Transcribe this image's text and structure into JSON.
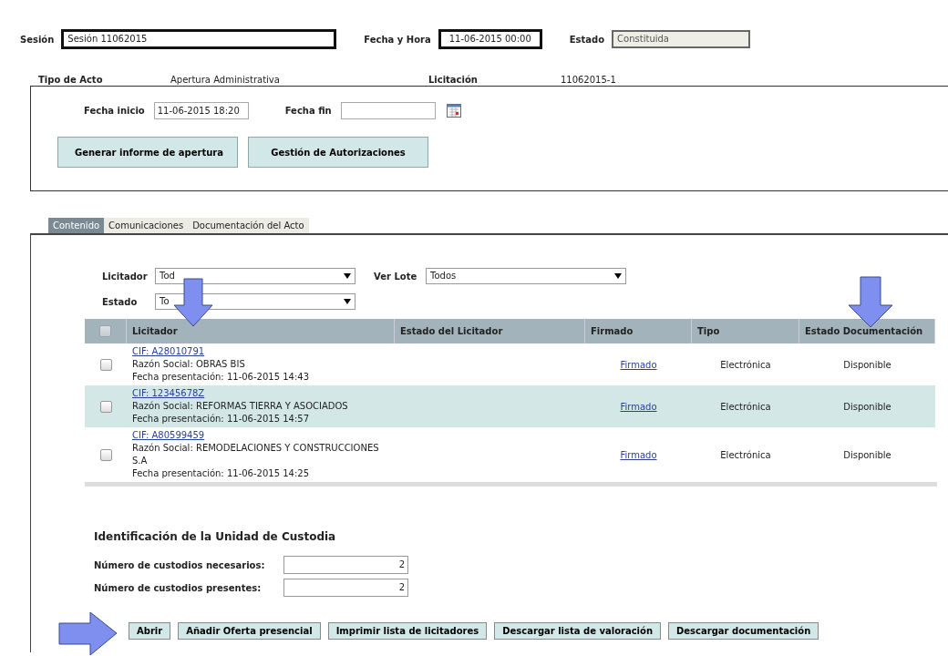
{
  "session": {
    "label": "Sesión",
    "value": "Sesión 11062015"
  },
  "date_time": {
    "label": "Fecha y Hora",
    "value": "11-06-2015 00:00"
  },
  "status": {
    "label": "Estado",
    "value": "Constituida",
    "disabled": true
  },
  "info": [
    {
      "label": "Tipo de Acto",
      "value": "Apertura Administrativa"
    },
    {
      "label": "Licitación",
      "value": "11062015-1"
    }
  ],
  "dates": [
    {
      "label": "Fecha inicio",
      "value": "11-06-2015 18:20"
    },
    {
      "label": "Fecha fin"
    }
  ],
  "panel_buttons": [
    "Generar informe de apertura",
    "Gestión de Autorizaciones"
  ],
  "tabs": [
    {
      "label": "Contenido",
      "selected": true
    },
    {
      "label": "Comunicaciones",
      "selected": false
    },
    {
      "label": "Documentación del Acto",
      "selected": false
    }
  ],
  "filters": [
    {
      "label": "Licitador",
      "value": "Tod"
    },
    {
      "label": "Ver Lote",
      "value": "Todos"
    },
    {
      "label": "Estado",
      "value": "To"
    }
  ],
  "table": {
    "select_all": {
      "disabled": true
    },
    "columns": [
      "Licitador",
      "Estado del Licitador",
      "Firmado",
      "Tipo",
      "Estado Documentación"
    ],
    "rows": [
      {
        "cif": "CIF: A28010791",
        "razon": "Razón Social: OBRAS BIS",
        "fecha": "Fecha presentación: 11-06-2015 14:43",
        "firmado": "Firmado",
        "tipo": "Electrónica",
        "estado_doc": "Disponible",
        "selected": false,
        "checked": false
      },
      {
        "cif": "CIF: 12345678Z",
        "razon": "Razón Social: REFORMAS TIERRA Y ASOCIADOS",
        "fecha": "Fecha presentación: 11-06-2015 14:57",
        "firmado": "Firmado",
        "tipo": "Electrónica",
        "estado_doc": "Disponible",
        "selected": true,
        "checked": false
      },
      {
        "cif": "CIF: A80599459",
        "razon": "Razón Social: REMODELACIONES Y CONSTRUCCIONES S.A",
        "fecha": "Fecha presentación: 11-06-2015 14:25",
        "firmado": "Firmado",
        "tipo": "Electrónica",
        "estado_doc": "Disponible",
        "selected": false,
        "checked": false
      }
    ]
  },
  "custody": {
    "title": "Identificación de la Unidad de Custodia",
    "fields": [
      {
        "label": "Número de custodios necesarios:",
        "value": "2"
      },
      {
        "label": "Número de custodios presentes:",
        "value": "2"
      }
    ]
  },
  "buttons": [
    "Abrir",
    "Añadir Oferta presencial",
    "Imprimir lista de licitadores",
    "Descargar lista de valoración",
    "Descargar documentación"
  ]
}
